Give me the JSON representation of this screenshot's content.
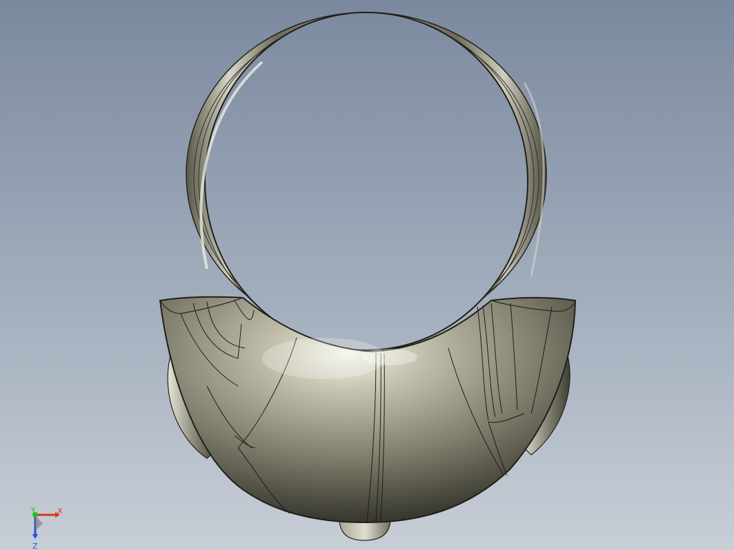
{
  "viewport": {
    "background_top": "#7d8ba1",
    "background_bottom": "#c5cbd3",
    "model_color": "#8f8d7a"
  },
  "model": {
    "name": "ring-pendant-model",
    "parts": [
      "ring-loop",
      "pendant-body",
      "bottom-knob",
      "side-lugs"
    ]
  },
  "triad": {
    "x_label": "X",
    "y_label": "Y",
    "z_label": "Z",
    "x_color": "#e03020",
    "y_color": "#20c020",
    "z_color": "#2050e0"
  }
}
